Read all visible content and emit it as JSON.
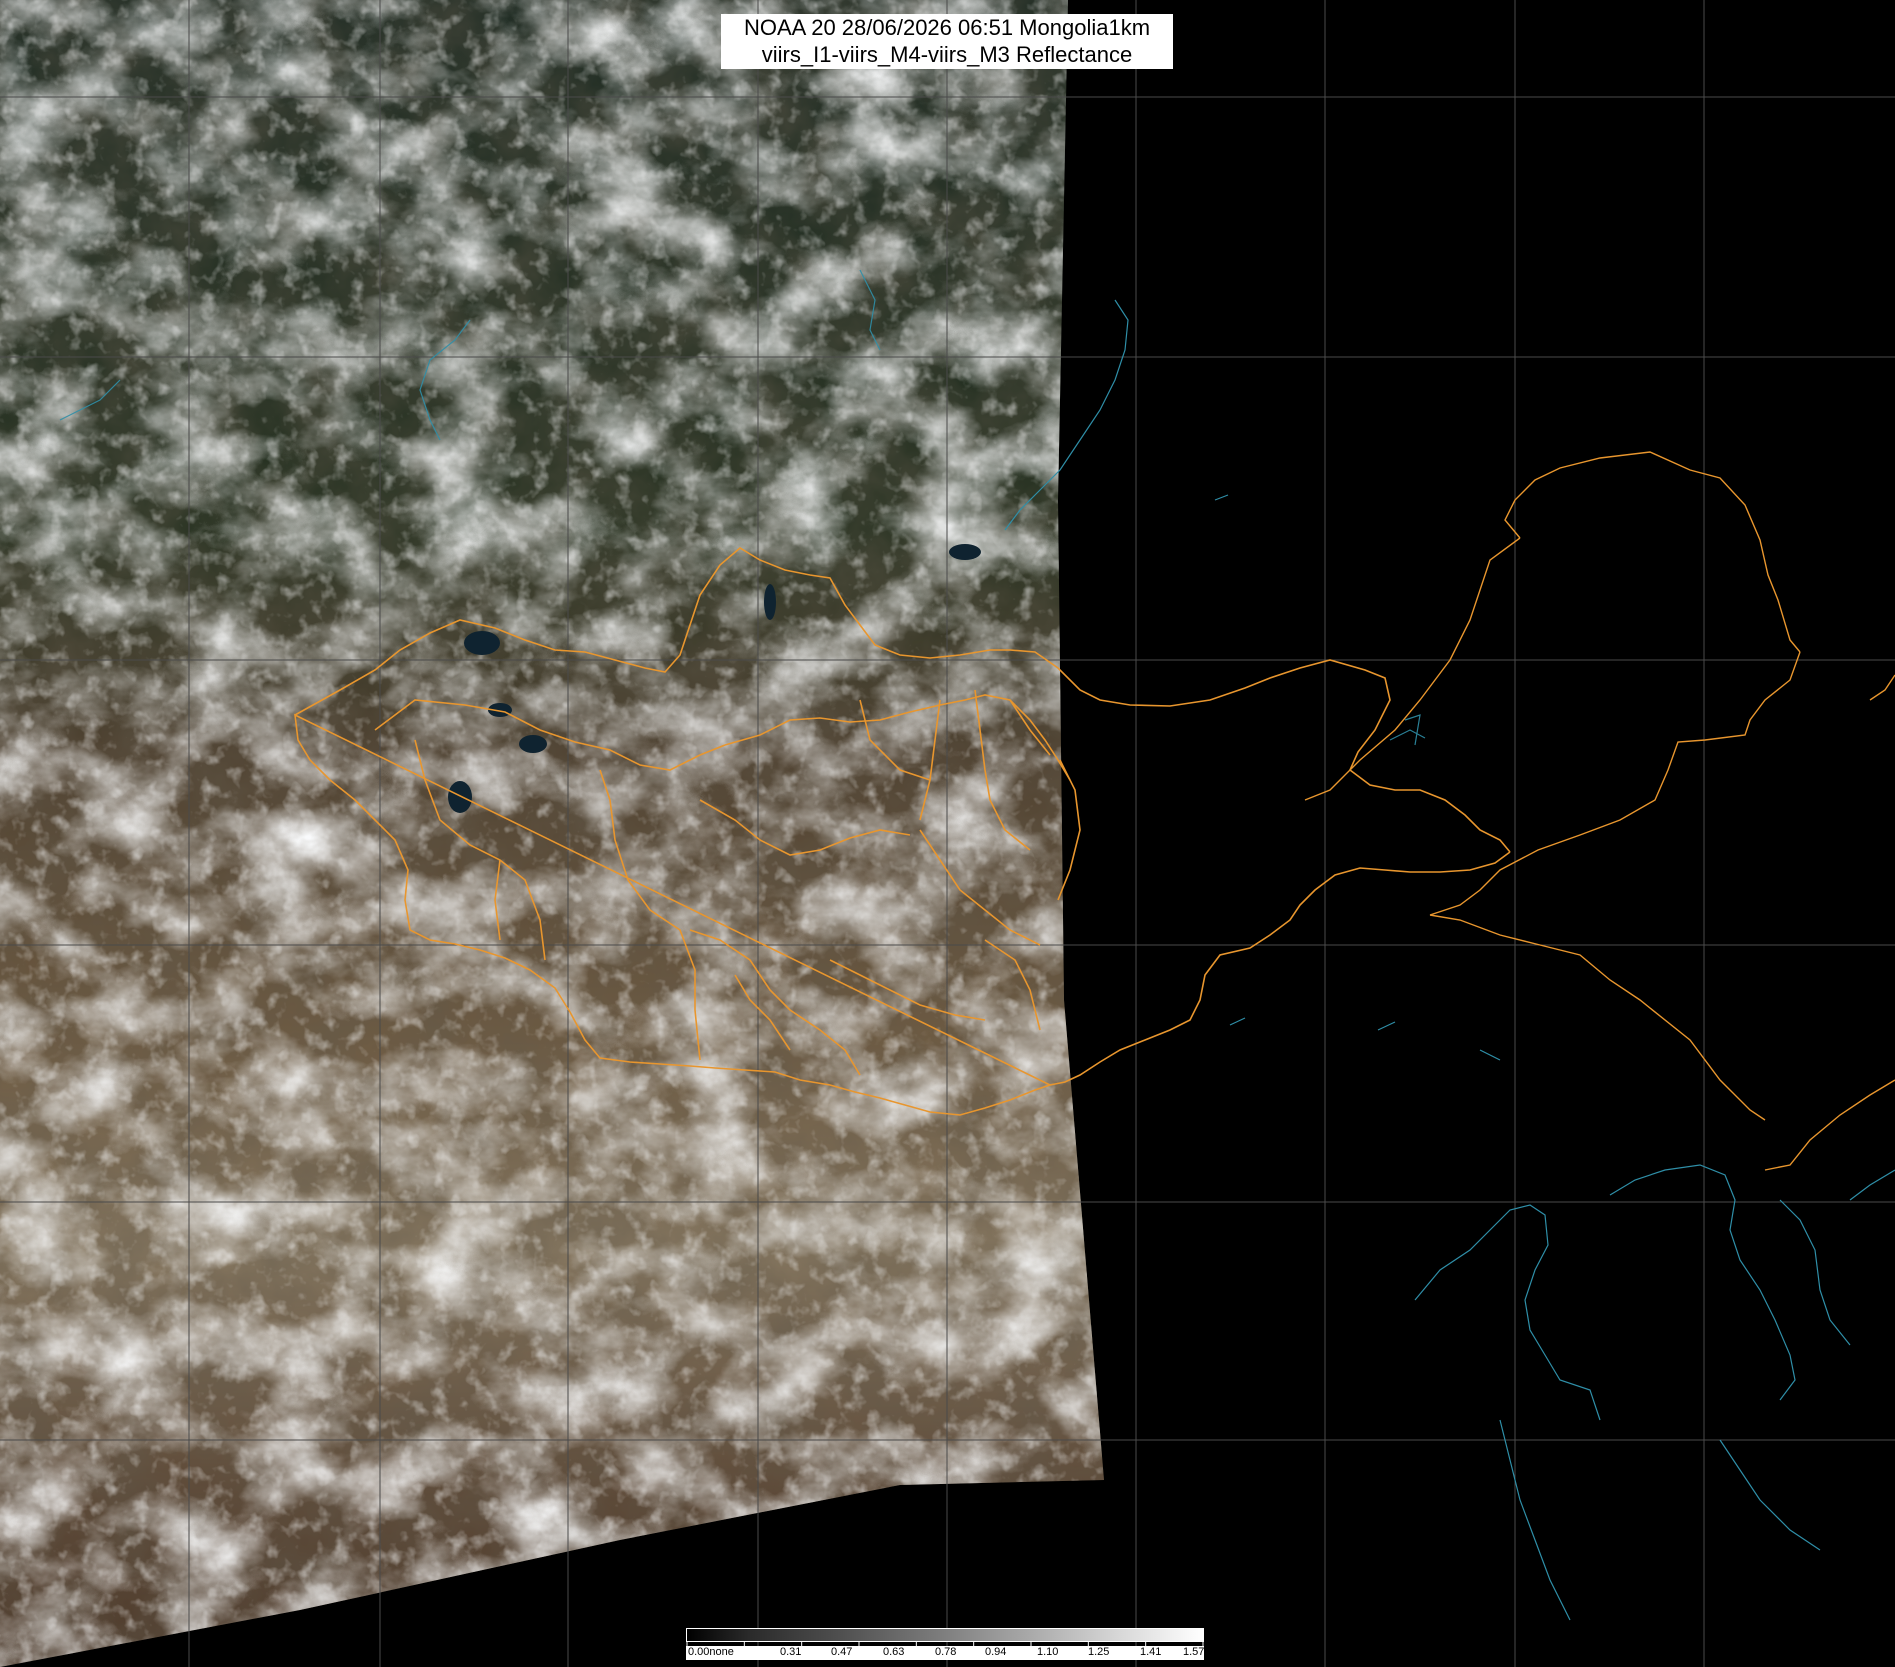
{
  "title": {
    "line1": "NOAA 20 28/06/2026 06:51 Mongolia1km",
    "line2": "viirs_I1-viirs_M4-viirs_M3 Reflectance"
  },
  "colorbar": {
    "labels": [
      "0.00none",
      "0.31",
      "0.47",
      "0.63",
      "0.78",
      "0.94",
      "1.10",
      "1.25",
      "1.41",
      "1.57"
    ]
  },
  "colors": {
    "background": "#000000",
    "grid": "#4a4a4a",
    "border": "#e8962e",
    "coastline": "#2f8fa8",
    "cloud": "#f0f2f4",
    "land_brown": "#6b5a44",
    "land_green": "#26302a"
  }
}
